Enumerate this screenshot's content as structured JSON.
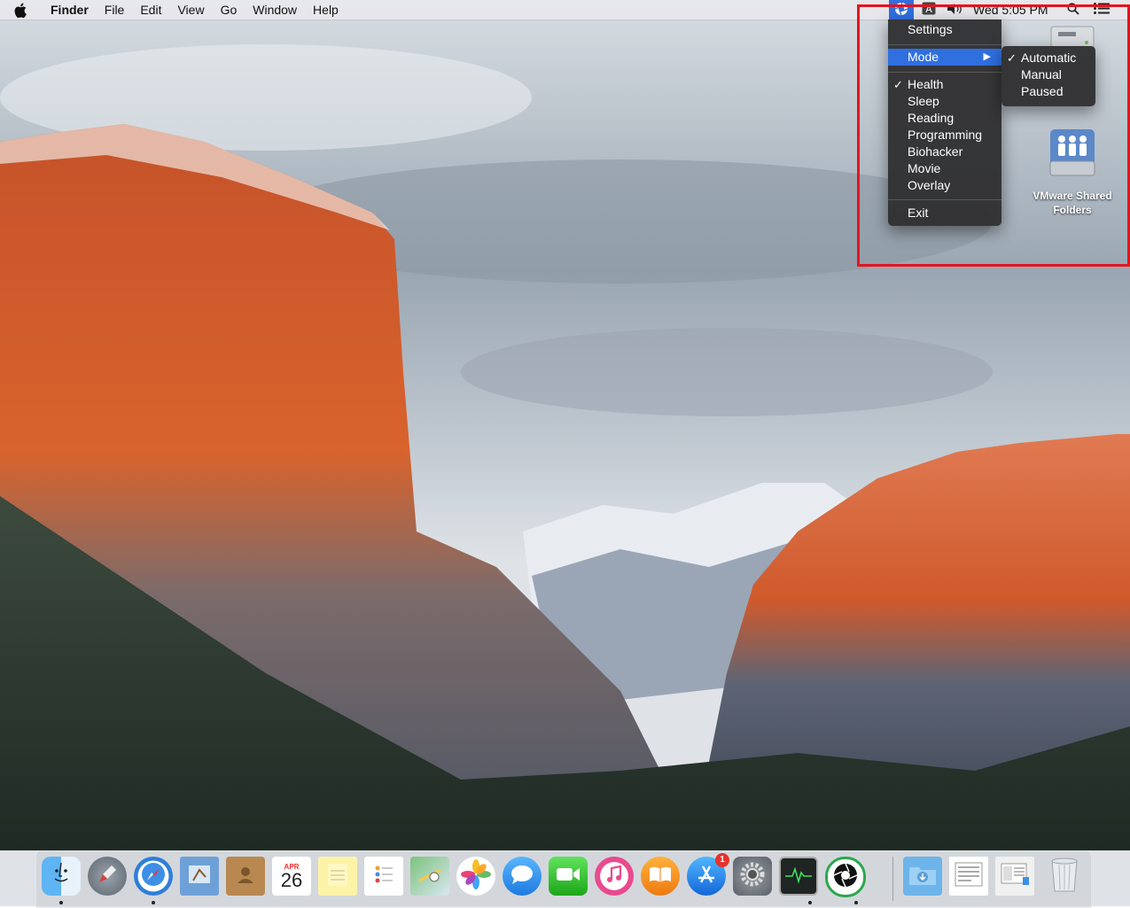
{
  "menubar": {
    "app_name": "Finder",
    "menus": [
      "File",
      "Edit",
      "View",
      "Go",
      "Window",
      "Help"
    ],
    "clock": "Wed 5:05 PM"
  },
  "status_menu": {
    "items": [
      {
        "label": "Settings"
      },
      {
        "label": "Mode",
        "submenu": true,
        "highlighted": true
      },
      {
        "label": "Health",
        "checked": true
      },
      {
        "label": "Sleep"
      },
      {
        "label": "Reading"
      },
      {
        "label": "Programming"
      },
      {
        "label": "Biohacker"
      },
      {
        "label": "Movie"
      },
      {
        "label": "Overlay"
      },
      {
        "label": "Exit"
      }
    ],
    "check_glyph": "✓",
    "submenu_arrow": "▶"
  },
  "mode_submenu": {
    "items": [
      {
        "label": "Automatic",
        "checked": true
      },
      {
        "label": "Manual"
      },
      {
        "label": "Paused"
      }
    ]
  },
  "desktop_icons": [
    {
      "label": "VMware Shared Folders",
      "icon": "shared-folder-drive-icon"
    },
    {
      "label": "",
      "icon": "hard-drive-icon"
    }
  ],
  "dock": {
    "apps": [
      {
        "name": "Finder",
        "icon": "finder-icon"
      },
      {
        "name": "Launchpad",
        "icon": "launchpad-icon"
      },
      {
        "name": "Safari",
        "icon": "safari-icon"
      },
      {
        "name": "Mail",
        "icon": "mail-icon"
      },
      {
        "name": "Contacts",
        "icon": "contacts-icon"
      },
      {
        "name": "Calendar",
        "icon": "calendar-icon",
        "month": "APR",
        "day": "26"
      },
      {
        "name": "Notes",
        "icon": "notes-icon"
      },
      {
        "name": "Reminders",
        "icon": "reminders-icon"
      },
      {
        "name": "Maps",
        "icon": "maps-icon"
      },
      {
        "name": "Photos",
        "icon": "photos-icon"
      },
      {
        "name": "Messages",
        "icon": "messages-icon"
      },
      {
        "name": "FaceTime",
        "icon": "facetime-icon"
      },
      {
        "name": "iTunes",
        "icon": "itunes-icon"
      },
      {
        "name": "iBooks",
        "icon": "ibooks-icon"
      },
      {
        "name": "App Store",
        "icon": "app-store-icon",
        "badge": "1"
      },
      {
        "name": "System Preferences",
        "icon": "system-preferences-icon"
      },
      {
        "name": "Activity Monitor",
        "icon": "activity-monitor-icon"
      },
      {
        "name": "Iris",
        "icon": "iris-aperture-icon"
      },
      {
        "name": "Downloads",
        "icon": "downloads-folder-icon"
      },
      {
        "name": "Document",
        "icon": "document-stack-icon"
      },
      {
        "name": "Screenshot",
        "icon": "screenshot-stack-icon"
      },
      {
        "name": "Trash",
        "icon": "trash-icon"
      }
    ]
  },
  "colors": {
    "highlight": "#2f6fe0",
    "annotation_box": "#e5141e",
    "menu_bg": "#303032"
  }
}
